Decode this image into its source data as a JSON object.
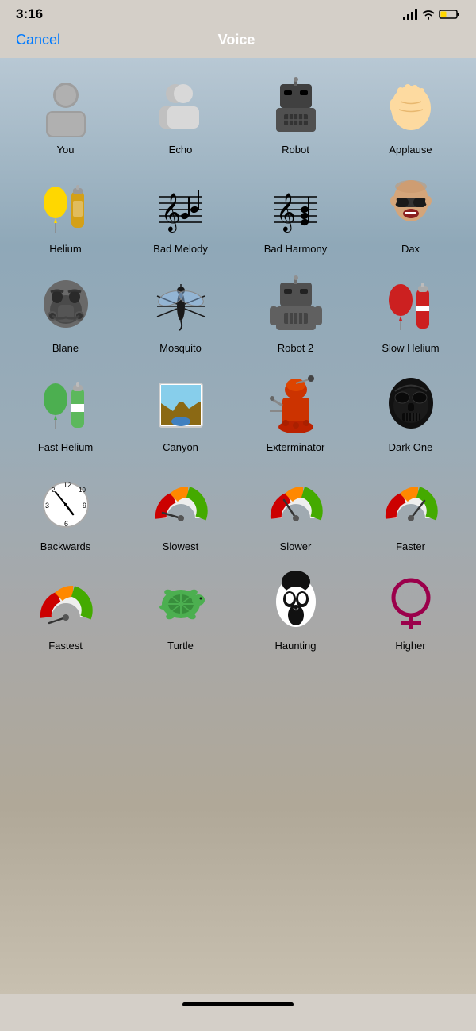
{
  "statusBar": {
    "time": "3:16",
    "signal": "full",
    "wifi": "on",
    "battery": "low"
  },
  "nav": {
    "cancel": "Cancel",
    "title": "Voice"
  },
  "voices": [
    {
      "id": "you",
      "label": "You"
    },
    {
      "id": "echo",
      "label": "Echo"
    },
    {
      "id": "robot",
      "label": "Robot"
    },
    {
      "id": "applause",
      "label": "Applause"
    },
    {
      "id": "helium",
      "label": "Helium"
    },
    {
      "id": "bad-melody",
      "label": "Bad Melody"
    },
    {
      "id": "bad-harmony",
      "label": "Bad Harmony"
    },
    {
      "id": "dax",
      "label": "Dax"
    },
    {
      "id": "blane",
      "label": "Blane"
    },
    {
      "id": "mosquito",
      "label": "Mosquito"
    },
    {
      "id": "robot2",
      "label": "Robot 2"
    },
    {
      "id": "slow-helium",
      "label": "Slow Helium"
    },
    {
      "id": "fast-helium",
      "label": "Fast Helium"
    },
    {
      "id": "canyon",
      "label": "Canyon"
    },
    {
      "id": "exterminator",
      "label": "Exterminator"
    },
    {
      "id": "dark-one",
      "label": "Dark One"
    },
    {
      "id": "backwards",
      "label": "Backwards"
    },
    {
      "id": "slowest",
      "label": "Slowest"
    },
    {
      "id": "slower",
      "label": "Slower"
    },
    {
      "id": "faster",
      "label": "Faster"
    },
    {
      "id": "fastest",
      "label": "Fastest"
    },
    {
      "id": "turtle",
      "label": "Turtle"
    },
    {
      "id": "haunting",
      "label": "Haunting"
    },
    {
      "id": "higher",
      "label": "Higher"
    }
  ]
}
